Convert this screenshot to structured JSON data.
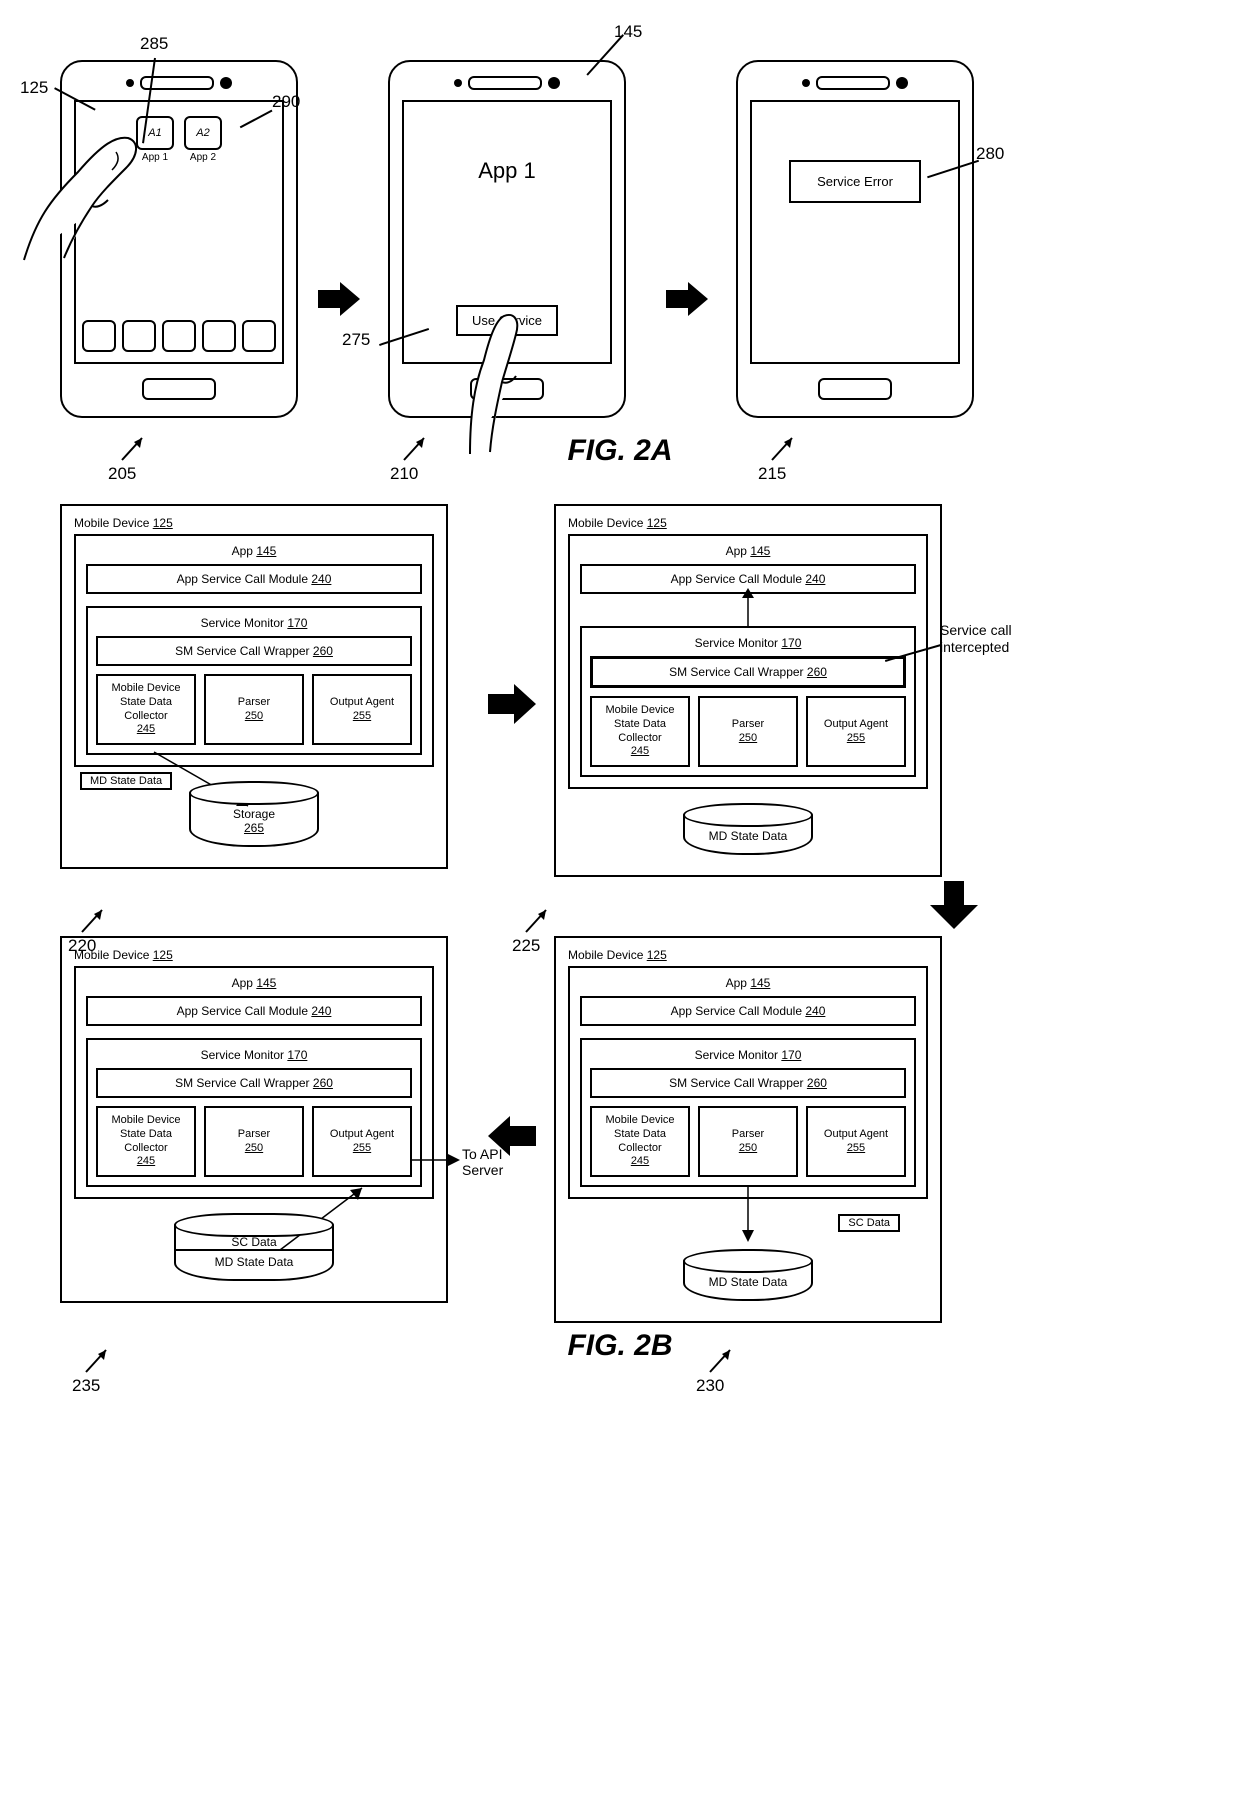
{
  "fig2a": {
    "title": "FIG. 2A",
    "refs": {
      "r125": "125",
      "r285": "285",
      "r290": "290",
      "r145": "145",
      "r275": "275",
      "r280": "280",
      "r205": "205",
      "r210": "210",
      "r215": "215"
    },
    "phone1": {
      "a1": "A1",
      "a2": "A2",
      "a1_label": "App 1",
      "a2_label": "App 2"
    },
    "phone2": {
      "title": "App 1",
      "button": "Use Service"
    },
    "phone3": {
      "error": "Service Error"
    }
  },
  "fig2b": {
    "title": "FIG. 2B",
    "refs": {
      "r220": "220",
      "r225": "225",
      "r230": "230",
      "r235": "235"
    },
    "labels": {
      "mobile_device": "Mobile Device",
      "md_ref": "125",
      "app": "App",
      "app_ref": "145",
      "ascm": "App Service Call Module",
      "ascm_ref": "240",
      "sm": "Service Monitor",
      "sm_ref": "170",
      "wrap": "SM Service Call Wrapper",
      "wrap_ref": "260",
      "collector": "Mobile Device State Data Collector",
      "collector_ref": "245",
      "parser": "Parser",
      "parser_ref": "250",
      "agent": "Output Agent",
      "agent_ref": "255",
      "storage": "Storage",
      "storage_ref": "265",
      "md_state": "MD State Data",
      "sc_data": "SC Data",
      "intercepted": "Service call intercepted",
      "to_api": "To API Server"
    }
  }
}
